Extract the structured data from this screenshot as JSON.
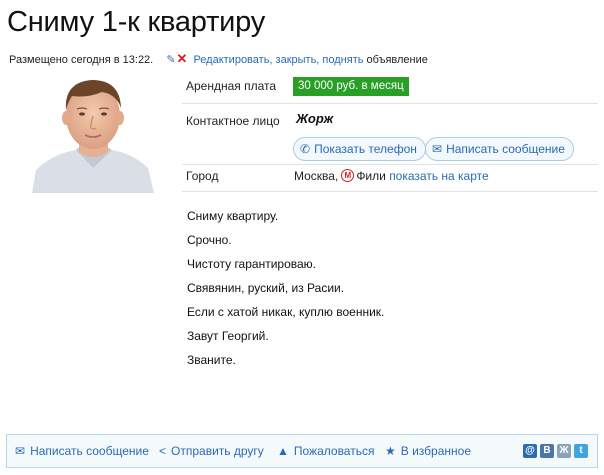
{
  "title": "Сниму 1-к квартиру",
  "meta": {
    "posted": "Размещено сегодня в 13:22.",
    "actions_link": "Редактировать, закрыть, поднять",
    "actions_suffix": "объявление"
  },
  "details": {
    "rent_label": "Арендная плата",
    "rent_value": "30 000 руб. в месяц",
    "contact_label": "Контактное лицо",
    "contact_name": "Жорж",
    "show_phone": "Показать телефон",
    "write_message": "Написать сообщение",
    "city_label": "Город",
    "city": "Москва,",
    "metro_icon_letter": "М",
    "metro_station": "Фили",
    "map_link": "показать на карте"
  },
  "description": [
    "Сниму квартиру.",
    "Срочно.",
    "Чистоту гарантироваю.",
    "Свявянин, руский, из Расии.",
    "Если с хатой никак, куплю военник.",
    "Завут Георгий.",
    "Званите."
  ],
  "bottom_bar": {
    "write_message": "Написать сообщение",
    "send_friend": "Отправить другу",
    "complain": "Пожаловаться",
    "favorites": "В избранное"
  },
  "social": [
    "@",
    "В",
    "Ж",
    "t"
  ],
  "colors": {
    "accent_link": "#2a6bb5",
    "price_bg": "#2a9f25",
    "delete_red": "#d0201d",
    "bar_border": "#b9d6e8"
  }
}
